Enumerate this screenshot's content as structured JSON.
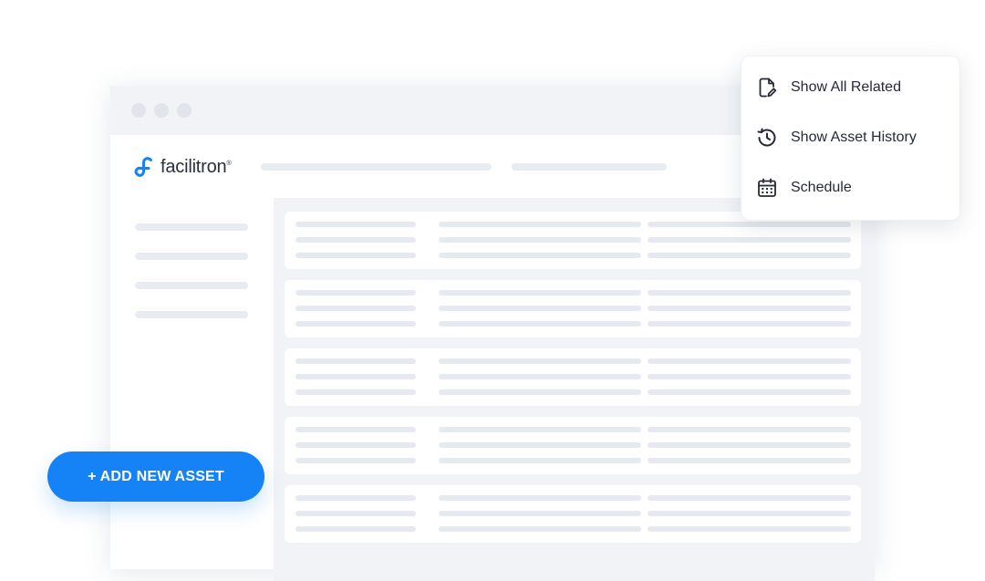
{
  "brand": {
    "name": "facilitron",
    "trademark": "®",
    "color": "#1583f5",
    "icon": "facilitron-logo-icon"
  },
  "window_controls": [
    "window-dot-icon",
    "window-dot-icon",
    "window-dot-icon"
  ],
  "context_menu": {
    "items": [
      {
        "label": "Show All Related",
        "icon": "document-edit-icon"
      },
      {
        "label": "Show Asset History",
        "icon": "history-icon"
      },
      {
        "label": "Schedule",
        "icon": "calendar-icon"
      }
    ]
  },
  "actions": {
    "add_asset_label": "+ ADD NEW ASSET",
    "add_asset_color": "#1583f5"
  },
  "colors": {
    "placeholder": "#e6e9ef",
    "panel_background": "#f1f3f7",
    "text": "#252a35"
  }
}
